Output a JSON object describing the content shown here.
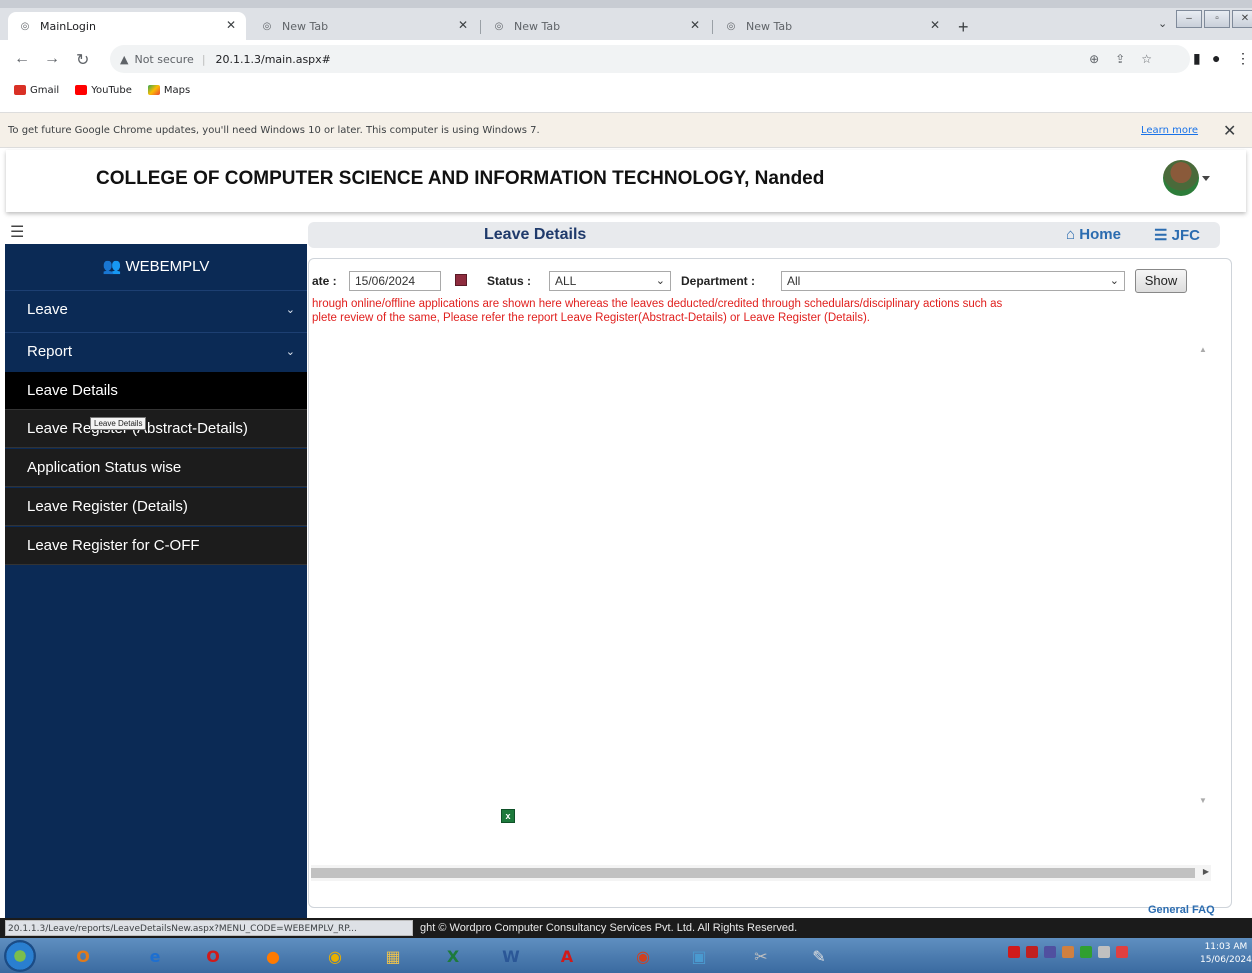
{
  "browser": {
    "tabs": [
      {
        "label": "MainLogin"
      },
      {
        "label": "New Tab"
      },
      {
        "label": "New Tab"
      },
      {
        "label": "New Tab"
      }
    ],
    "address": {
      "security": "Not secure",
      "url": "20.1.1.3/main.aspx#"
    },
    "bookmarks": [
      {
        "label": "Gmail"
      },
      {
        "label": "YouTube"
      },
      {
        "label": "Maps"
      }
    ],
    "infobar": {
      "message": "To get future Google Chrome updates, you'll need Windows 10 or later. This computer is using Windows 7.",
      "learn_more": "Learn more"
    }
  },
  "header": {
    "college": "COLLEGE OF COMPUTER SCIENCE AND INFORMATION TECHNOLOGY, Nanded"
  },
  "titlebar": {
    "title": "Leave Details",
    "home": "Home",
    "jfc": "JFC"
  },
  "sidebar": {
    "brand": "WEBEMPLV",
    "menus": [
      {
        "label": "Leave"
      },
      {
        "label": "Report"
      }
    ],
    "items": [
      {
        "label": "Leave Details"
      },
      {
        "label": "Leave Register (Abstract-Details)"
      },
      {
        "label": "Application Status wise"
      },
      {
        "label": "Leave Register (Details)"
      },
      {
        "label": "Leave Register for C-OFF"
      }
    ],
    "tooltip": "Leave Details"
  },
  "filters": {
    "date_label": "ate :",
    "date_value": "15/06/2024",
    "status_label": "Status :",
    "status_value": "ALL",
    "department_label": "Department :",
    "department_value": "All",
    "show": "Show"
  },
  "notice": {
    "line1": "hrough online/offline applications are shown here whereas the leaves deducted/credited through schedulars/disciplinary actions such as",
    "line2": "plete review of the same, Please refer the report Leave Register(Abstract-Details) or Leave Register (Details)."
  },
  "footer": {
    "status_url": "20.1.1.3/Leave/reports/LeaveDetailsNew.aspx?MENU_CODE=WEBEMPLV_RP...",
    "copyright": "ght © Wordpro Computer Consultancy Services Pvt. Ltd. All Rights Reserved.",
    "faq": "General FAQ"
  },
  "taskbar": {
    "time": "11:03 AM",
    "date": "15/06/2024"
  }
}
